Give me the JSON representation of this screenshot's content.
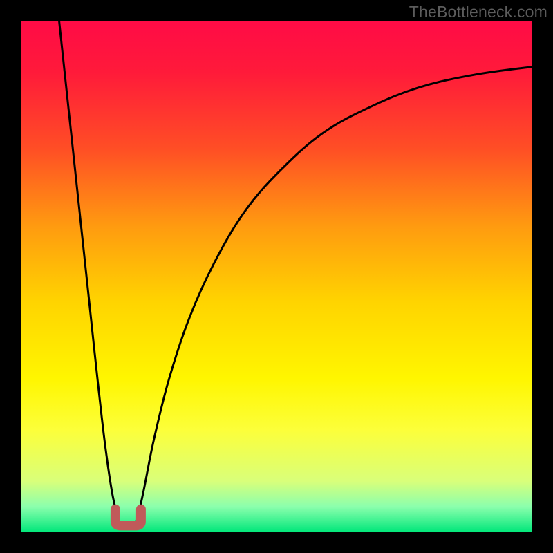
{
  "watermark": "TheBottleneck.com",
  "chart_data": {
    "type": "line",
    "title": "",
    "xlabel": "",
    "ylabel": "",
    "xlim": [
      0,
      1
    ],
    "ylim": [
      0,
      1
    ],
    "gradient_stops": [
      {
        "offset": 0.0,
        "color": "#ff0b46"
      },
      {
        "offset": 0.1,
        "color": "#ff1a3a"
      },
      {
        "offset": 0.25,
        "color": "#ff4e25"
      },
      {
        "offset": 0.4,
        "color": "#ff9a10"
      },
      {
        "offset": 0.55,
        "color": "#ffd400"
      },
      {
        "offset": 0.7,
        "color": "#fff600"
      },
      {
        "offset": 0.8,
        "color": "#fcff3a"
      },
      {
        "offset": 0.9,
        "color": "#d9ff7a"
      },
      {
        "offset": 0.95,
        "color": "#8bffad"
      },
      {
        "offset": 1.0,
        "color": "#00e77a"
      }
    ],
    "series": [
      {
        "name": "left-branch",
        "comment": "x: horizontal fraction 0..1 of plot width, y: bottleneck fraction 0=bottom/good, 1=top/bad",
        "x": [
          0.075,
          0.09,
          0.105,
          0.12,
          0.135,
          0.15,
          0.165,
          0.18,
          0.195
        ],
        "y": [
          1.0,
          0.86,
          0.72,
          0.58,
          0.44,
          0.3,
          0.17,
          0.07,
          0.013
        ]
      },
      {
        "name": "right-branch",
        "x": [
          0.225,
          0.24,
          0.26,
          0.29,
          0.33,
          0.38,
          0.44,
          0.51,
          0.59,
          0.68,
          0.78,
          0.89,
          1.0
        ],
        "y": [
          0.013,
          0.08,
          0.18,
          0.3,
          0.42,
          0.53,
          0.63,
          0.71,
          0.78,
          0.83,
          0.87,
          0.895,
          0.91
        ]
      }
    ],
    "valley": {
      "name": "valley-marker",
      "color": "#c05a5a",
      "x_center": 0.21,
      "y_bottom": 0.013,
      "width_frac": 0.05,
      "height_frac": 0.032
    }
  }
}
